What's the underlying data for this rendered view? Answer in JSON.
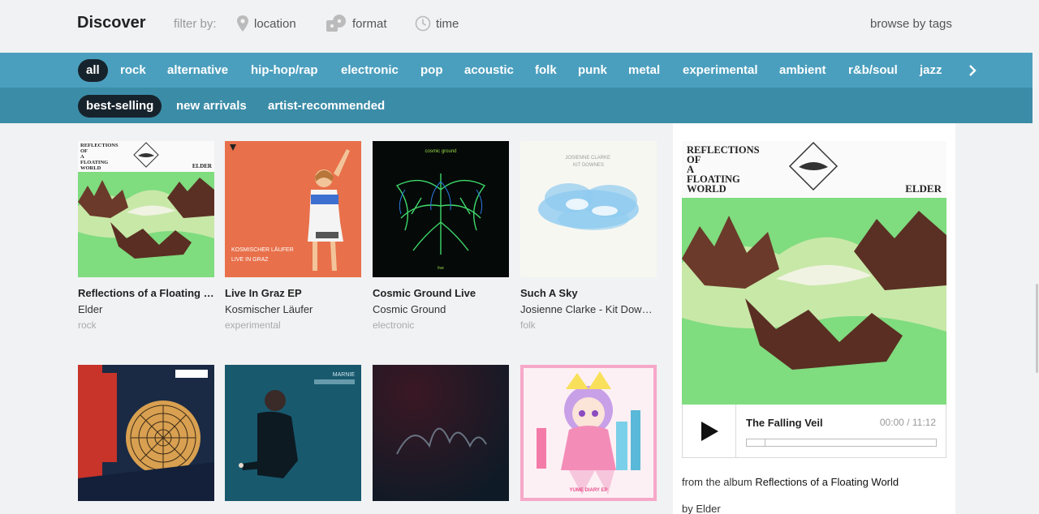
{
  "header": {
    "title": "Discover",
    "filter_label": "filter by:",
    "filters": [
      {
        "label": "location",
        "icon": "location-pin-icon"
      },
      {
        "label": "format",
        "icon": "format-icon"
      },
      {
        "label": "time",
        "icon": "clock-icon"
      }
    ],
    "browse_label": "browse by tags"
  },
  "genres": [
    "all",
    "rock",
    "alternative",
    "hip-hop/rap",
    "electronic",
    "pop",
    "acoustic",
    "folk",
    "punk",
    "metal",
    "experimental",
    "ambient",
    "r&b/soul",
    "jazz"
  ],
  "active_genre": "all",
  "sort_tabs": [
    "best-selling",
    "new arrivals",
    "artist-recommended"
  ],
  "active_sort": "best-selling",
  "albums": [
    {
      "title": "Reflections of a Floating World",
      "artist": "Elder",
      "genre": "rock"
    },
    {
      "title": "Live In Graz EP",
      "artist": "Kosmischer Läufer",
      "genre": "experimental"
    },
    {
      "title": "Cosmic Ground Live",
      "artist": "Cosmic Ground",
      "genre": "electronic"
    },
    {
      "title": "Such A Sky",
      "artist": "Josienne Clarke - Kit Downes",
      "genre": "folk"
    },
    {
      "title": "",
      "artist": "",
      "genre": ""
    },
    {
      "title": "",
      "artist": "",
      "genre": ""
    },
    {
      "title": "",
      "artist": "",
      "genre": ""
    },
    {
      "title": "",
      "artist": "",
      "genre": ""
    }
  ],
  "covers": {
    "reflections": {
      "line1": "REFLECTIONS",
      "line2": "OF",
      "line3": "A",
      "line4": "FLOATING",
      "line5": "WORLD",
      "artist": "ELDER"
    },
    "graz": {
      "line1": "KOSMISCHER LÄUFER",
      "line2": "LIVE IN GRAZ"
    },
    "cosmic": {
      "line1": "cosmic ground",
      "line2": "live"
    },
    "sky": {
      "line1": "JOSIENNE CLARKE",
      "line2": "KIT DOWNES"
    },
    "marnie": {
      "line1": "MARNIE"
    },
    "anime": {
      "line1": "YUME DIARY EP"
    }
  },
  "featured": {
    "track": "The Falling Veil",
    "time": "00:00 / 11:12",
    "progress": 0.1,
    "from_prefix": "from the album",
    "album": "Reflections of a Floating World",
    "by": "by Elder"
  },
  "colors": {
    "genre_bar": "#4b9fbe",
    "sort_bar": "#3b8ca7",
    "active_pill": "#17232c"
  }
}
